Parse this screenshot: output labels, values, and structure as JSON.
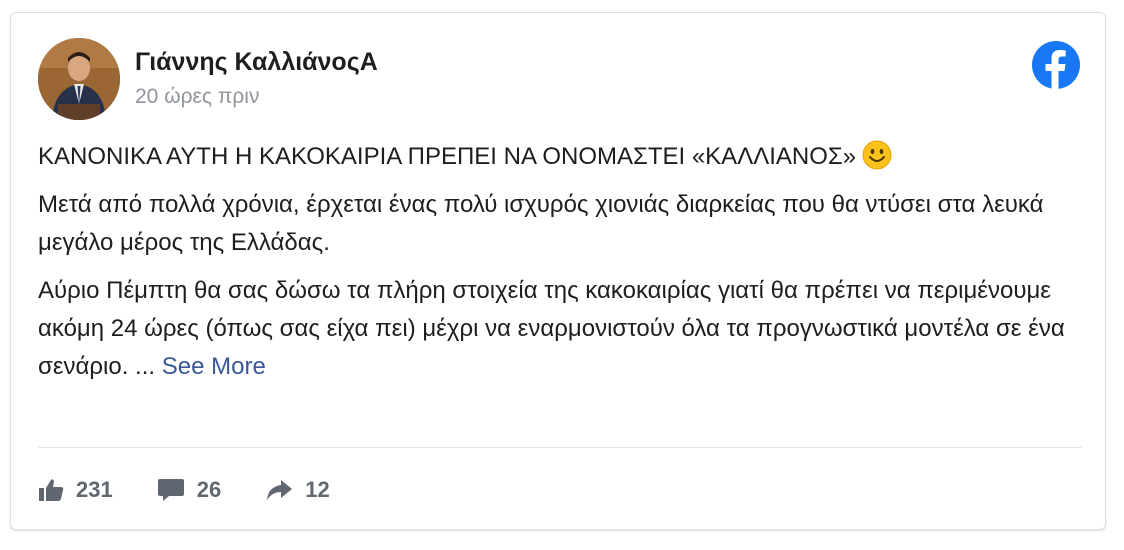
{
  "post": {
    "author": "Γιάννης ΚαλλιάνοςΑ",
    "time": "20 ώρες πριν",
    "paragraph1": "ΚΑΝΟΝΙΚΑ ΑΥΤΗ Η ΚΑΚΟΚΑΙΡΙΑ ΠΡΕΠΕΙ ΝΑ ΟΝΟΜΑΣΤΕΙ «ΚΑΛΛΙΑΝΟΣ»",
    "paragraph2": "Μετά από πολλά χρόνια, έρχεται ένας πολύ ισχυρός χιονιάς διαρκείας που θα ντύσει στα λευκά μεγάλο μέρος της Ελλάδας.",
    "paragraph3": "Αύριο Πέμπτη θα σας δώσω τα πλήρη στοιχεία της κακοκαιρίας γιατί θα πρέπει να περιμένουμε ακόμη 24 ώρες (όπως σας είχα πει) μέχρι να εναρμονιστούν όλα τα προγνωστικά μοντέλα σε ένα σενάριο. ...",
    "see_more": "See More"
  },
  "actions": {
    "likes": "231",
    "comments": "26",
    "shares": "12"
  },
  "icons": {
    "facebook": "facebook-logo-icon",
    "emoji": "smiley-emoji-icon",
    "like": "thumbs-up-icon",
    "comment": "comment-bubble-icon",
    "share": "share-arrow-icon"
  },
  "colors": {
    "facebook_blue": "#1877f2",
    "link": "#385898",
    "muted": "#606770"
  }
}
